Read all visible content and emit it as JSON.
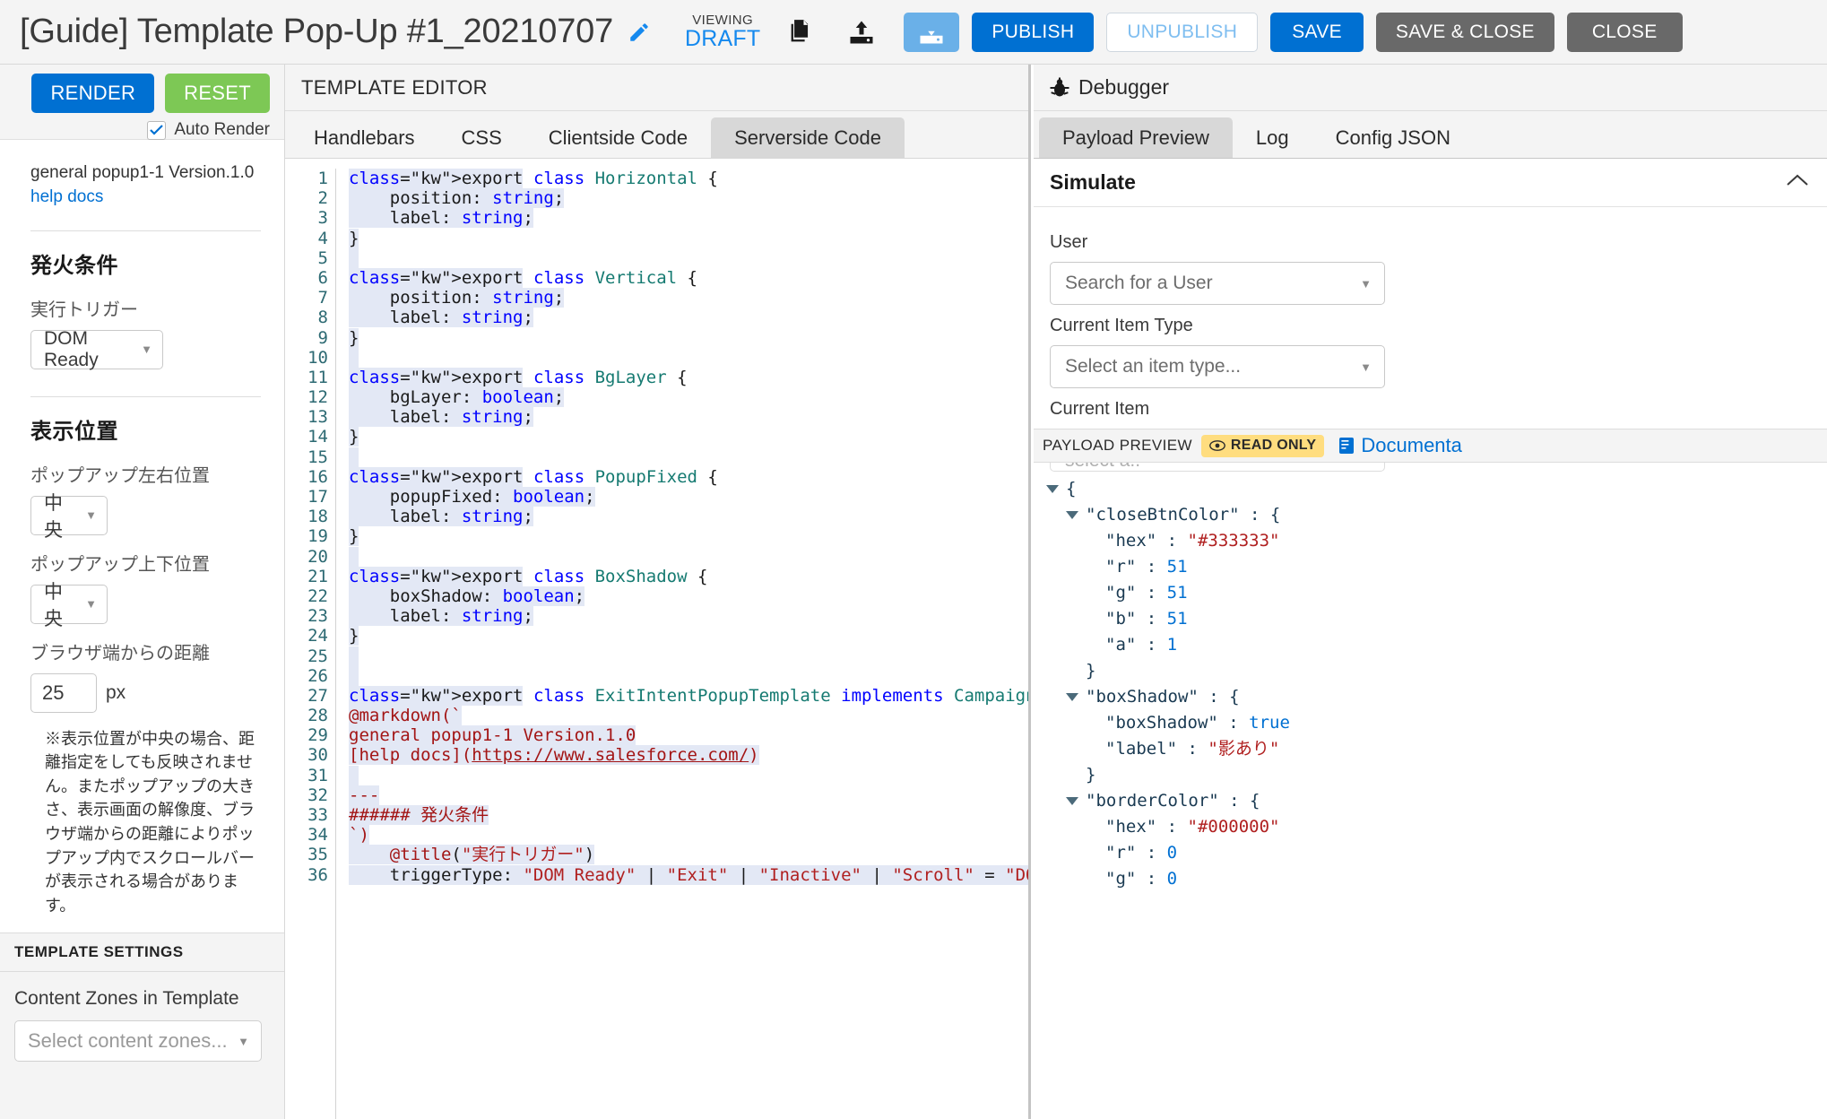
{
  "topbar": {
    "title": "[Guide] Template Pop-Up #1_20210707",
    "edit_icon": "pencil-icon",
    "viewing_label": "VIEWING",
    "viewing_state": "DRAFT",
    "copy_icon": "copy-icon",
    "upload_icon": "upload-icon",
    "import_icon": "import-icon",
    "buttons": [
      {
        "id": "publish",
        "label": "PUBLISH"
      },
      {
        "id": "unpublish",
        "label": "UNPUBLISH"
      },
      {
        "id": "save",
        "label": "SAVE"
      },
      {
        "id": "save_close",
        "label": "SAVE & CLOSE"
      },
      {
        "id": "close",
        "label": "CLOSE"
      }
    ],
    "accent_blue": "#0070d2",
    "grey_button": "#696969"
  },
  "left": {
    "render_label": "RENDER",
    "reset_label": "RESET",
    "auto_render_label": "Auto Render",
    "auto_render_checked": true,
    "template_version": "general popup1-1 Version.1.0",
    "help_docs": "help docs",
    "section_trigger_title": "発火条件",
    "trigger_label": "実行トリガー",
    "trigger_value": "DOM Ready",
    "section_position_title": "表示位置",
    "pos_h_label": "ポップアップ左右位置",
    "pos_h_value": "中央",
    "pos_v_label": "ポップアップ上下位置",
    "pos_v_value": "中央",
    "dist_label": "ブラウザ端からの距離",
    "dist_value": "25",
    "dist_unit": "px",
    "note": "※表示位置が中央の場合、距離指定をしても反映されません。またポップアップの大きさ、表示画面の解像度、ブラウザ端からの距離によりポップアップ内でスクロールバーが表示される場合があります。",
    "template_settings_header": "TEMPLATE SETTINGS",
    "content_zones_label": "Content Zones in Template",
    "content_zones_placeholder": "Select content zones..."
  },
  "center": {
    "header": "TEMPLATE EDITOR",
    "tabs": [
      {
        "label": "Handlebars",
        "active": false
      },
      {
        "label": "CSS",
        "active": false
      },
      {
        "label": "Clientside Code",
        "active": false
      },
      {
        "label": "Serverside Code",
        "active": true
      }
    ],
    "first_line_number": 1,
    "last_line_number": 36,
    "code_lines": [
      "export class Horizontal {",
      "    position: string;",
      "    label: string;",
      "}",
      "",
      "export class Vertical {",
      "    position: string;",
      "    label: string;",
      "}",
      "",
      "export class BgLayer {",
      "    bgLayer: boolean;",
      "    label: string;",
      "}",
      "",
      "export class PopupFixed {",
      "    popupFixed: boolean;",
      "    label: string;",
      "}",
      "",
      "export class BoxShadow {",
      "    boxShadow: boolean;",
      "    label: string;",
      "}",
      "",
      "",
      "export class ExitIntentPopupTemplate implements CampaignTemplateComponent {",
      "@markdown(`",
      "general popup1-1 Version.1.0",
      "[help docs](https://www.salesforce.com/)",
      "",
      "---",
      "###### 発火条件",
      "`)",
      "    @title(\"実行トリガー\")",
      "    triggerType: \"DOM Ready\" | \"Exit\" | \"Inactive\" | \"Scroll\" = \"DOM Ready\" ;"
    ]
  },
  "right": {
    "header": "Debugger",
    "bug_icon": "bug-icon",
    "tabs": [
      {
        "label": "Payload Preview",
        "active": true
      },
      {
        "label": "Log",
        "active": false
      },
      {
        "label": "Config JSON",
        "active": false
      }
    ],
    "simulate_title": "Simulate",
    "collapse_icon": "chevron-up-icon",
    "user_label": "User",
    "user_placeholder": "Search for a User",
    "item_type_label": "Current Item Type",
    "item_type_placeholder": "Select an item type...",
    "current_item_label": "Current Item",
    "current_item_placeholder": "Select an item type first to then select a..",
    "payload_bar_title": "PAYLOAD PREVIEW",
    "readonly_chip": "READ ONLY",
    "readonly_icon": "eye-icon",
    "doc_link": "Documenta",
    "doc_icon": "book-icon",
    "readonly_chip_color": "#ffdd7f",
    "json_rows": [
      {
        "depth": 0,
        "tri": "down",
        "text": "{"
      },
      {
        "depth": 1,
        "tri": "down",
        "key": "\"closeBtnColor\"",
        "sep": " : ",
        "punc": "{"
      },
      {
        "depth": 2,
        "tri": "none",
        "key": "\"hex\"",
        "sep": " : ",
        "str": "\"#333333\""
      },
      {
        "depth": 2,
        "tri": "none",
        "key": "\"r\"",
        "sep": " : ",
        "num": "51"
      },
      {
        "depth": 2,
        "tri": "none",
        "key": "\"g\"",
        "sep": " : ",
        "num": "51"
      },
      {
        "depth": 2,
        "tri": "none",
        "key": "\"b\"",
        "sep": " : ",
        "num": "51"
      },
      {
        "depth": 2,
        "tri": "none",
        "key": "\"a\"",
        "sep": " : ",
        "num": "1"
      },
      {
        "depth": 1,
        "tri": "none",
        "punc": "}"
      },
      {
        "depth": 1,
        "tri": "down",
        "key": "\"boxShadow\"",
        "sep": " : ",
        "punc": "{"
      },
      {
        "depth": 2,
        "tri": "none",
        "key": "\"boxShadow\"",
        "sep": " : ",
        "bool": "true"
      },
      {
        "depth": 2,
        "tri": "none",
        "key": "\"label\"",
        "sep": " : ",
        "str": "\"影あり\""
      },
      {
        "depth": 1,
        "tri": "none",
        "punc": "}"
      },
      {
        "depth": 1,
        "tri": "down",
        "key": "\"borderColor\"",
        "sep": " : ",
        "punc": "{"
      },
      {
        "depth": 2,
        "tri": "none",
        "key": "\"hex\"",
        "sep": " : ",
        "str": "\"#000000\""
      },
      {
        "depth": 2,
        "tri": "none",
        "key": "\"r\"",
        "sep": " : ",
        "num": "0"
      },
      {
        "depth": 2,
        "tri": "none",
        "key": "\"g\"",
        "sep": " : ",
        "num": "0"
      }
    ]
  }
}
